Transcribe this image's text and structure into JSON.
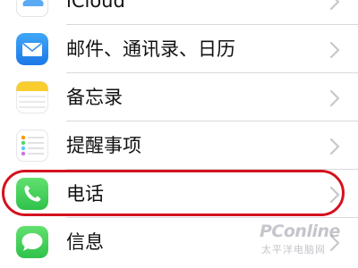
{
  "settings": {
    "items": [
      {
        "label": "iCloud",
        "icon": "icloud-icon"
      },
      {
        "label": "邮件、通讯录、日历",
        "icon": "mail-icon"
      },
      {
        "label": "备忘录",
        "icon": "notes-icon"
      },
      {
        "label": "提醒事项",
        "icon": "reminders-icon"
      },
      {
        "label": "电话",
        "icon": "phone-icon"
      },
      {
        "label": "信息",
        "icon": "messages-icon"
      }
    ]
  },
  "highlight": {
    "target": "电话",
    "color": "#d4121f"
  },
  "watermark": {
    "main": "PConline",
    "sub": "太平洋电脑网"
  },
  "colors": {
    "mail": "#2f8ff2",
    "phone": "#4cd964",
    "messages": "#4cd964",
    "chevron": "#c7c7cc",
    "separator": "#d9d9dd"
  }
}
